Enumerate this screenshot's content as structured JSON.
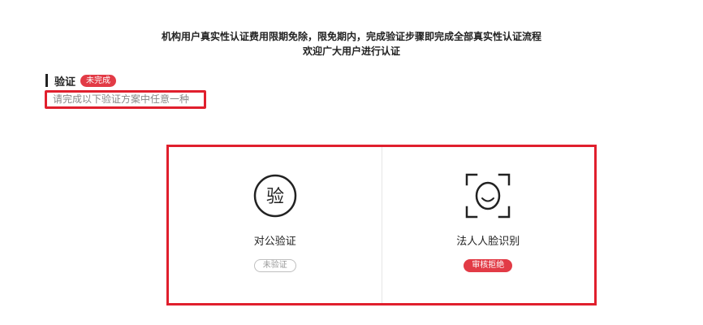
{
  "notice": {
    "line1": "机构用户真实性认证费用限期免除，限免期内，完成验证步骤即完成全部真实性认证流程",
    "line2": "欢迎广大用户进行认证"
  },
  "verification": {
    "title": "验证",
    "status": "未完成",
    "instruction": "请完成以下验证方案中任意一种"
  },
  "options": [
    {
      "icon_char": "验",
      "icon": "verify-char-icon",
      "label": "对公验证",
      "status": "未验证"
    },
    {
      "icon": "face-scan-icon",
      "label": "法人人脸识别",
      "status": "审核拒绝"
    }
  ],
  "colors": {
    "accent_red": "#e23b46",
    "highlight_border": "#e01f2d"
  }
}
